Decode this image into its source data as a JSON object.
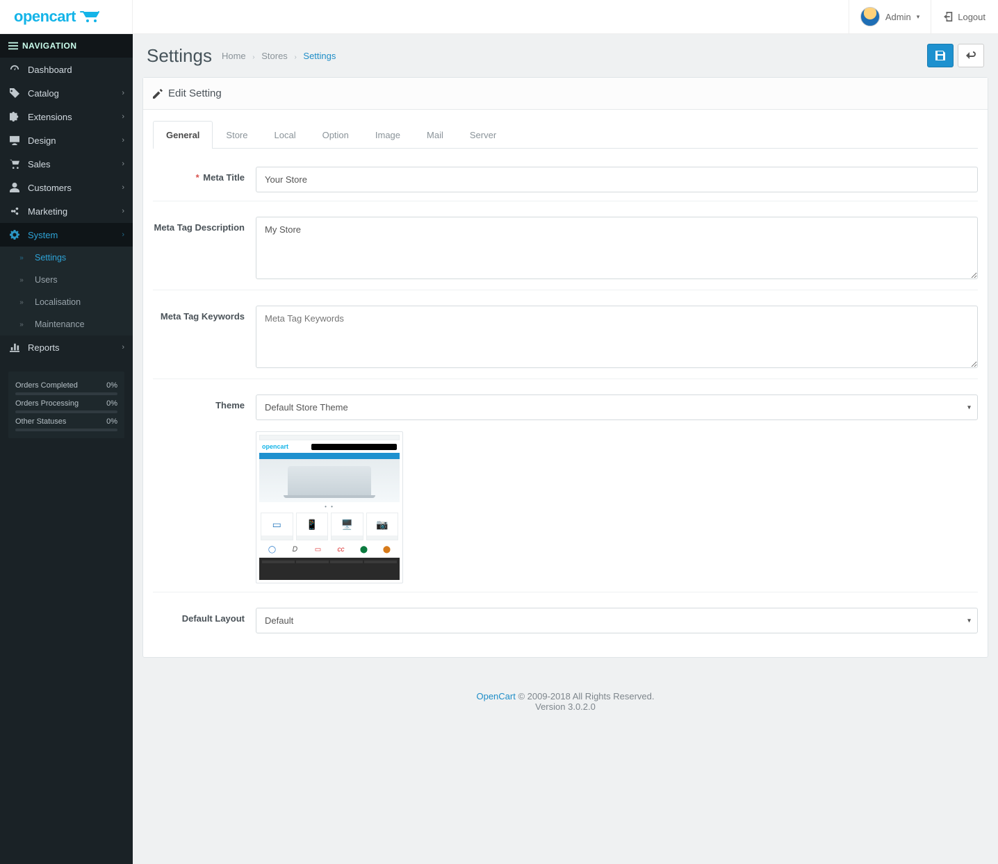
{
  "brand": {
    "name": "opencart",
    "color": "#14b4e8"
  },
  "header": {
    "user_name": "Admin",
    "logout_label": "Logout"
  },
  "sidebar": {
    "nav_label": "NAVIGATION",
    "items": [
      {
        "key": "dashboard",
        "label": "Dashboard",
        "has_children": false
      },
      {
        "key": "catalog",
        "label": "Catalog",
        "has_children": true
      },
      {
        "key": "extensions",
        "label": "Extensions",
        "has_children": true
      },
      {
        "key": "design",
        "label": "Design",
        "has_children": true
      },
      {
        "key": "sales",
        "label": "Sales",
        "has_children": true
      },
      {
        "key": "customers",
        "label": "Customers",
        "has_children": true
      },
      {
        "key": "marketing",
        "label": "Marketing",
        "has_children": true
      },
      {
        "key": "system",
        "label": "System",
        "has_children": true,
        "active": true
      },
      {
        "key": "reports",
        "label": "Reports",
        "has_children": true
      }
    ],
    "system_children": [
      {
        "key": "settings",
        "label": "Settings",
        "active": true
      },
      {
        "key": "users",
        "label": "Users"
      },
      {
        "key": "localisation",
        "label": "Localisation"
      },
      {
        "key": "maintenance",
        "label": "Maintenance"
      }
    ],
    "stats": [
      {
        "label": "Orders Completed",
        "value": "0%"
      },
      {
        "label": "Orders Processing",
        "value": "0%"
      },
      {
        "label": "Other Statuses",
        "value": "0%"
      }
    ]
  },
  "page": {
    "title": "Settings",
    "breadcrumb": {
      "home": "Home",
      "stores": "Stores",
      "settings": "Settings"
    }
  },
  "panel": {
    "title": "Edit Setting"
  },
  "tabs": [
    "General",
    "Store",
    "Local",
    "Option",
    "Image",
    "Mail",
    "Server"
  ],
  "form": {
    "meta_title": {
      "label": "Meta Title",
      "value": "Your Store",
      "required": true
    },
    "meta_description": {
      "label": "Meta Tag Description",
      "value": "My Store"
    },
    "meta_keywords": {
      "label": "Meta Tag Keywords",
      "placeholder": "Meta Tag Keywords",
      "value": ""
    },
    "theme": {
      "label": "Theme",
      "selected": "Default Store Theme"
    },
    "default_layout": {
      "label": "Default Layout",
      "selected": "Default"
    }
  },
  "footer": {
    "brand": "OpenCart",
    "copyright": "© 2009-2018 All Rights Reserved.",
    "version": "Version 3.0.2.0"
  }
}
